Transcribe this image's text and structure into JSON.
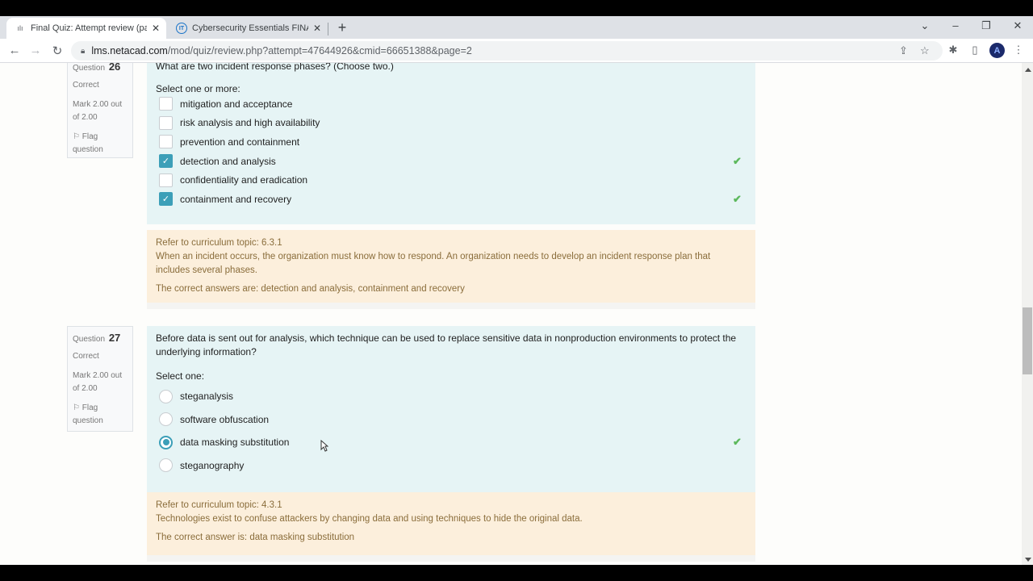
{
  "browser": {
    "tabs": [
      {
        "title": "Final Quiz: Attempt review (page",
        "favicon": "cisco-icon",
        "active": true
      },
      {
        "title": "Cybersecurity Essentials FINAL Q",
        "favicon": "it-icon",
        "active": false
      }
    ],
    "new_tab": "+",
    "url_host": "lms.netacad.com",
    "url_path": "/mod/quiz/review.php?attempt=47644926&cmid=66651388&page=2",
    "profile_initial": "A"
  },
  "questions": [
    {
      "number_label": "Question",
      "number": "26",
      "status": "Correct",
      "mark": "Mark 2.00 out of 2.00",
      "flag": "Flag question",
      "text": "What are two incident response phases? (Choose two.)",
      "prompt": "Select one or more:",
      "type": "checkbox",
      "options": [
        {
          "label": "mitigation and acceptance",
          "checked": false,
          "correct": false
        },
        {
          "label": "risk analysis and high availability",
          "checked": false,
          "correct": false
        },
        {
          "label": "prevention and containment",
          "checked": false,
          "correct": false
        },
        {
          "label": "detection and analysis",
          "checked": true,
          "correct": true
        },
        {
          "label": "confidentiality and eradication",
          "checked": false,
          "correct": false
        },
        {
          "label": "containment and recovery",
          "checked": true,
          "correct": true
        }
      ],
      "feedback_topic": "Refer to curriculum topic: 6.3.1",
      "feedback_text": "When an incident occurs, the organization must know how to respond. An organization needs to develop an incident response plan that includes several phases.",
      "correct_answer": "The correct answers are: detection and analysis, containment and recovery"
    },
    {
      "number_label": "Question",
      "number": "27",
      "status": "Correct",
      "mark": "Mark 2.00 out of 2.00",
      "flag": "Flag question",
      "text": "Before data is sent out for analysis, which technique can be used to replace sensitive data in nonproduction environments to protect the underlying information?",
      "prompt": "Select one:",
      "type": "radio",
      "options": [
        {
          "label": "steganalysis",
          "checked": false,
          "correct": false
        },
        {
          "label": "software obfuscation",
          "checked": false,
          "correct": false
        },
        {
          "label": "data masking substitution",
          "checked": true,
          "correct": true
        },
        {
          "label": "steganography",
          "checked": false,
          "correct": false
        }
      ],
      "feedback_topic": "Refer to curriculum topic: 4.3.1",
      "feedback_text": "Technologies exist to confuse attackers by changing data and using techniques to hide the original data.",
      "correct_answer": "The correct answer is: data masking substitution"
    }
  ],
  "colors": {
    "accent": "#3c9fb8",
    "correct_tick": "#5cb85c",
    "formulation_bg": "#e6f4f5",
    "feedback_bg": "#fcefdc",
    "feedback_text": "#8a6d3b"
  }
}
